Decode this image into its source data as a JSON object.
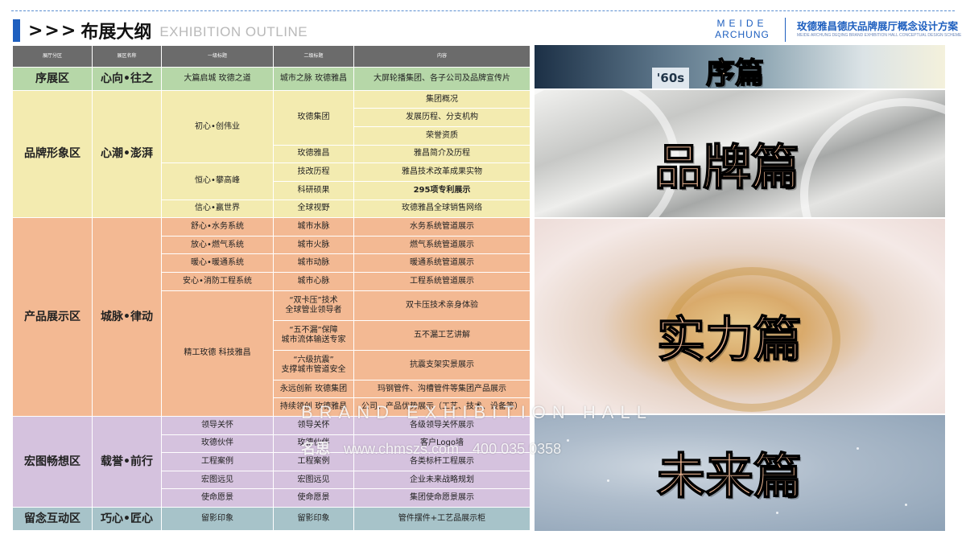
{
  "header": {
    "arrows": ">>>",
    "title": "布展大纲",
    "subtitle": "EXHIBITION OUTLINE",
    "brand_line1": "MEIDE",
    "brand_line2": "ARCHUNG",
    "project_title": "玫德雅昌德庆品牌展厅概念设计方案",
    "project_subtitle_en": "MEIDE ARCHUNG DEQING BRAND EXHIBITION HALL CONCEPTUAL DESIGN SCHEME",
    "accent_color": "#1e5fbf"
  },
  "table": {
    "headers": [
      "展厅分区",
      "展区名称",
      "一级标题",
      "二级标题",
      "内容"
    ],
    "zones": [
      {
        "zone": "序展区",
        "name": "心向•往之",
        "color": "#b6d7a8"
      },
      {
        "zone": "品牌形象区",
        "name": "心潮•澎湃",
        "color": "#f3ebb0"
      },
      {
        "zone": "产品展示区",
        "name": "城脉•律动",
        "color": "#f3b993"
      },
      {
        "zone": "宏图畅想区",
        "name": "载誉•前行",
        "color": "#d5c2de"
      },
      {
        "zone": "留念互动区",
        "name": "巧心•匠心",
        "color": "#a7c3c9"
      }
    ],
    "level1": {
      "intro": "大篇启城 玫德之道",
      "brand_a": "初心•创伟业",
      "brand_b": "恒心•攀高峰",
      "brand_c": "信心•赢世界",
      "prod_a": "舒心•水务系统",
      "prod_b": "放心•燃气系统",
      "prod_c": "暖心•暖通系统",
      "prod_d": "安心•消防工程系统",
      "prod_e": "精工玫德 科技雅昌",
      "future_a": "领导关怀",
      "future_b": "玫德伙伴",
      "future_c": "工程案例",
      "future_d": "宏图远见",
      "future_e": "使命愿景",
      "memento": "留影印象"
    },
    "level2": {
      "intro": "城市之脉 玫德雅昌",
      "brand_a1": "玫德集团",
      "brand_a2": "玫德雅昌",
      "brand_b1": "技改历程",
      "brand_b2": "科研硕果",
      "brand_c": "全球视野",
      "prod_a": "城市水脉",
      "prod_b": "城市火脉",
      "prod_c": "城市动脉",
      "prod_d": "城市心脉",
      "prod_e1": "“双卡压”技术\n全球管业领导者",
      "prod_e2": "“五不漏”保障\n城市流体输送专家",
      "prod_e3": "“六级抗震”\n支撑城市管道安全",
      "prod_e4": "永远创新 玫德集团",
      "prod_e5": "持续领创 玫德雅昌",
      "future_a": "领导关怀",
      "future_b": "玫德伙伴",
      "future_c": "工程案例",
      "future_d": "宏图远见",
      "future_e": "使命愿景",
      "memento": "留影印象"
    },
    "content": {
      "intro": "大屏轮播集团、各子公司及品牌宣传片",
      "brand_1": "集团概况",
      "brand_2": "发展历程、分支机构",
      "brand_3": "荣誉资质",
      "brand_4": "雅昌简介及历程",
      "brand_5": "雅昌技术改革成果实物",
      "brand_6": "295项专利展示",
      "brand_7": "玫德雅昌全球销售网络",
      "prod_1": "水务系统管道展示",
      "prod_2": "燃气系统管道展示",
      "prod_3": "暖通系统管道展示",
      "prod_4": "工程系统管道展示",
      "prod_5": "双卡压技术亲身体验",
      "prod_6": "五不漏工艺讲解",
      "prod_7": "抗震支架实景展示",
      "prod_8": "玛钢管件、沟槽管件等集团产品展示",
      "prod_9": "公司、产品优势展示（工艺、技术、设备等）",
      "future_1": "各级领导关怀展示",
      "future_2": "客户Logo墙",
      "future_3": "各类标杆工程展示",
      "future_4": "企业未来战略规划",
      "future_5": "集团使命愿景展示",
      "memento": "管件摆件+工艺品展示柜"
    }
  },
  "panels": {
    "p1_label": "序篇",
    "p1_wall_text": "'60s",
    "p2_label": "品牌篇",
    "p3_label": "实力篇",
    "p4_label": "未来篇"
  },
  "watermark": {
    "line1": "BRAND EXHIBITION HALL",
    "logo": "名思",
    "site": "www.chmszs.com",
    "phone": "400 035 0358"
  }
}
